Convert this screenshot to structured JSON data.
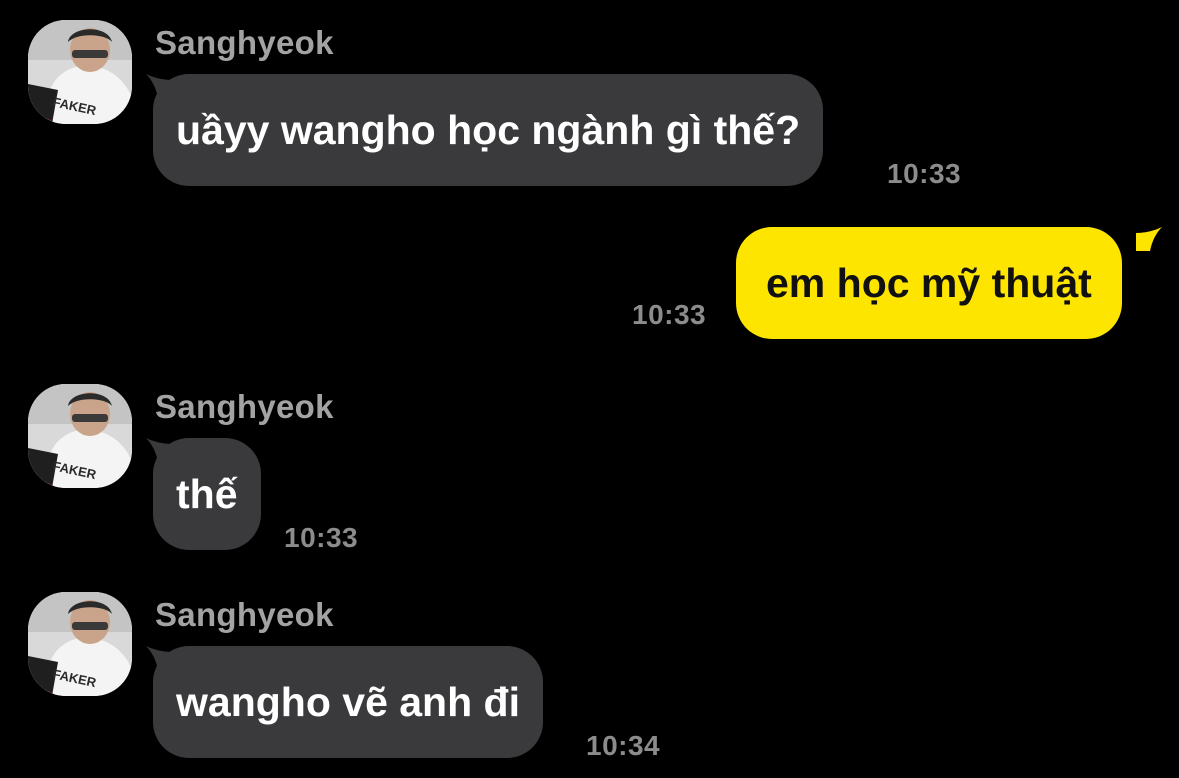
{
  "colors": {
    "background": "#000000",
    "incoming_bubble": "#3a3a3c",
    "outgoing_bubble": "#fee500",
    "sender_name": "#a3a3a3",
    "timestamp": "#8c8c8c"
  },
  "messages": [
    {
      "sender": "Sanghyeok",
      "text": "uầyy wangho học ngành gì thế?",
      "time": "10:33",
      "avatar_caption": "FAKER",
      "avatar_icon": "profile-photo-icon"
    },
    {
      "text": "em học mỹ thuật",
      "time": "10:33"
    },
    {
      "sender": "Sanghyeok",
      "text": "thế",
      "time": "10:33",
      "avatar_caption": "FAKER",
      "avatar_icon": "profile-photo-icon"
    },
    {
      "sender": "Sanghyeok",
      "text": "wangho vẽ anh đi",
      "time": "10:34",
      "avatar_caption": "FAKER",
      "avatar_icon": "profile-photo-icon"
    }
  ]
}
